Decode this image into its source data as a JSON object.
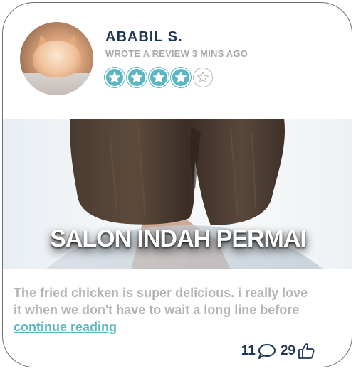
{
  "reviewer": {
    "name": "ABABIL S.",
    "subtitle": "WROTE A REVIEW 3 MINS AGO",
    "avatar_icon": "cat-avatar",
    "rating": 4,
    "rating_max": 5
  },
  "banner": {
    "title": "SALON INDAH PERMAI"
  },
  "review": {
    "text_line1": "The fried chicken is super delicious. i really love",
    "text_line2": "it when we don't have to wait a long line before",
    "continue_label": "continue reading"
  },
  "stats": {
    "comments_count": "11",
    "comments_icon": "speech-bubble-icon",
    "likes_count": "29",
    "likes_icon": "thumbs-up-icon"
  },
  "colors": {
    "accent": "#5bb6c4",
    "name": "#1d3557",
    "muted": "#a9a9a9"
  }
}
